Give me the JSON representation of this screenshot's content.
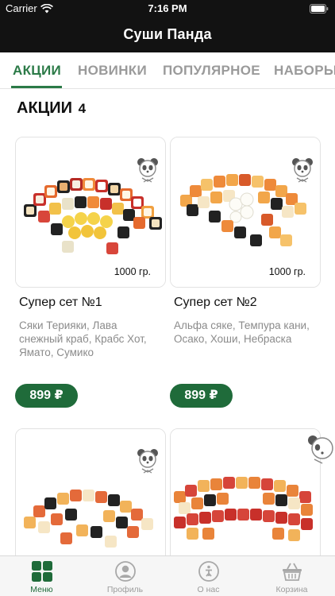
{
  "status_bar": {
    "carrier": "Carrier",
    "time": "7:16 PM"
  },
  "app": {
    "title": "Суши Панда"
  },
  "categories": [
    {
      "label": "АКЦИИ",
      "active": true
    },
    {
      "label": "НОВИНКИ",
      "active": false
    },
    {
      "label": "ПОПУЛЯРНОЕ",
      "active": false
    },
    {
      "label": "НАБОРЫ",
      "active": false
    }
  ],
  "section": {
    "title": "АКЦИИ",
    "count": "4"
  },
  "products": [
    {
      "weight": "1000 гр.",
      "name": "Супер сет №1",
      "description": "Сяки Терияки, Лава снежный краб, Крабс Хот, Ямато, Сумико",
      "price": "899 ₽"
    },
    {
      "weight": "1000 гр.",
      "name": "Супер сет №2",
      "description": "Альфа сяке, Темпура кани, Осако, Хоши, Небраска",
      "price": "899 ₽"
    },
    {
      "weight": "",
      "name": "",
      "description": "",
      "price": ""
    },
    {
      "weight": "",
      "name": "",
      "description": "",
      "price": ""
    }
  ],
  "tabbar": [
    {
      "label": "Меню",
      "icon": "grid-icon",
      "active": true
    },
    {
      "label": "Профиль",
      "icon": "profile-icon",
      "active": false
    },
    {
      "label": "О нас",
      "icon": "info-icon",
      "active": false
    },
    {
      "label": "Корзина",
      "icon": "basket-icon",
      "active": false
    }
  ],
  "colors": {
    "brand_green": "#1f6b3a",
    "tab_active": "#2b7a47",
    "header_bg": "#121212"
  }
}
